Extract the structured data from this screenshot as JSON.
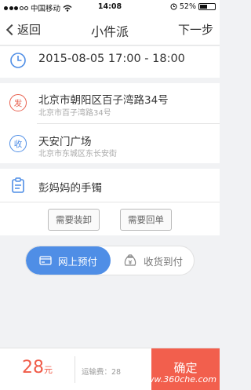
{
  "status_bar": {
    "carrier": "中国移动",
    "time": "14:08",
    "battery_percent": "52%",
    "battery_level": 0.52
  },
  "nav": {
    "back_label": "返回",
    "title": "小件派",
    "next_label": "下一步"
  },
  "pickup_time": "2015-08-05   17:00 - 18:00",
  "sender": {
    "tag": "发",
    "address_main": "北京市朝阳区百子湾路34号",
    "address_sub": "北京市百子湾路34号"
  },
  "receiver": {
    "tag": "收",
    "address_main": "天安门广场",
    "address_sub": "北京市东城区东长安街"
  },
  "item": {
    "name": "彭妈妈的手镯"
  },
  "options": {
    "loading": "需要装卸",
    "receipt": "需要回单"
  },
  "payment": {
    "online": "网上预付",
    "cod": "收货到付",
    "selected": "online"
  },
  "bottom": {
    "price_value": "28",
    "price_unit": "元",
    "freight_text": "运输费：28",
    "confirm_label": "确定",
    "watermark": "www.360che.com"
  },
  "colors": {
    "accent_blue": "#4f8ee6",
    "accent_red": "#f25f4d",
    "sender_red": "#e8604f"
  },
  "icons": [
    "back-chevron-icon",
    "clock-icon",
    "sender-location-icon",
    "receiver-location-icon",
    "clipboard-icon",
    "credit-card-icon",
    "cash-bag-icon",
    "wifi-icon",
    "alarm-icon",
    "battery-icon"
  ]
}
